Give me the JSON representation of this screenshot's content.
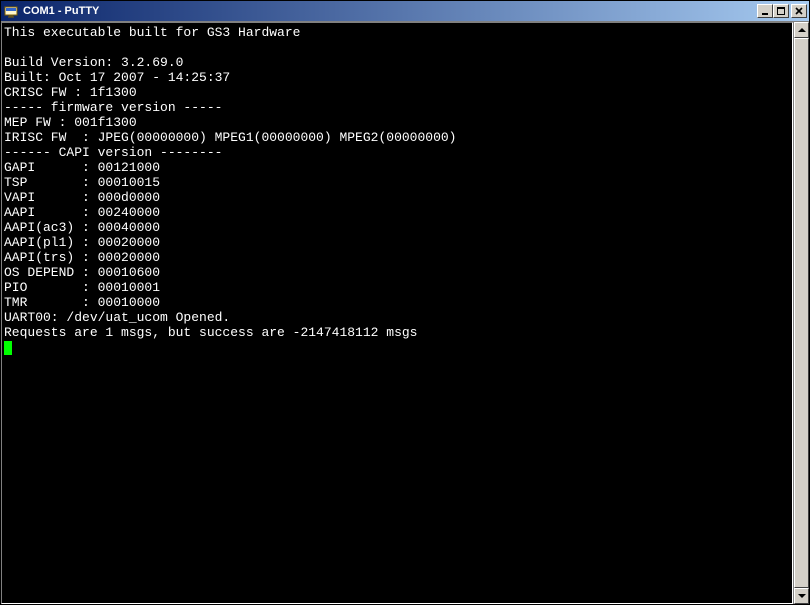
{
  "window": {
    "title": "COM1 - PuTTY"
  },
  "terminal": {
    "lines": [
      "This executable built for GS3 Hardware",
      "",
      "Build Version: 3.2.69.0",
      "Built: Oct 17 2007 - 14:25:37",
      "CRISC FW : 1f1300",
      "----- firmware version -----",
      "MEP FW : 001f1300",
      "IRISC FW  : JPEG(00000000) MPEG1(00000000) MPEG2(00000000)",
      "------ CAPI version --------",
      "GAPI      : 00121000",
      "TSP       : 00010015",
      "VAPI      : 000d0000",
      "AAPI      : 00240000",
      "AAPI(ac3) : 00040000",
      "AAPI(pl1) : 00020000",
      "AAPI(trs) : 00020000",
      "OS DEPEND : 00010600",
      "PIO       : 00010001",
      "TMR       : 00010000",
      "UART00: /dev/uat_ucom Opened.",
      "Requests are 1 msgs, but success are -2147418112 msgs"
    ]
  }
}
